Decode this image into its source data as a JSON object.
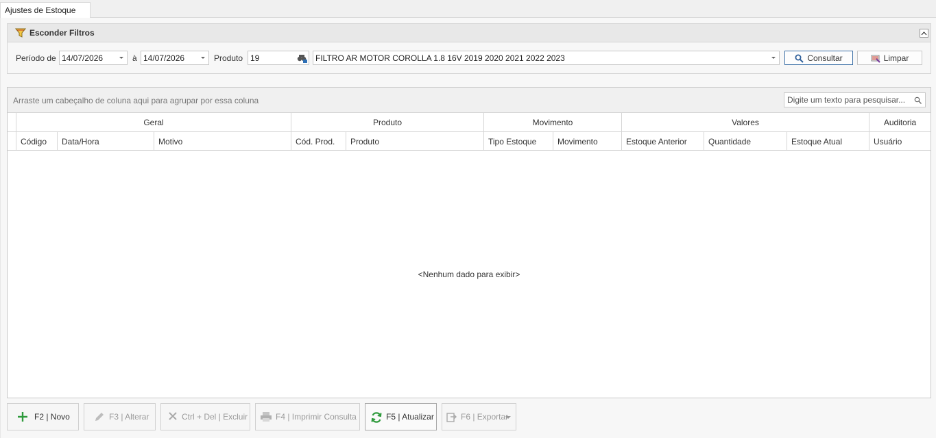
{
  "tab": {
    "label": "Ajustes de Estoque"
  },
  "filter": {
    "header_title": "Esconder Filtros",
    "periodo_label": "Período de",
    "date_from": "14/07/2026",
    "a_label": "à",
    "date_to": "14/07/2026",
    "produto_label": "Produto",
    "produto_code": "19",
    "produto_desc": "FILTRO AR MOTOR COROLLA 1.8 16V 2019 2020 2021 2022 2023",
    "consultar_label": "Consultar",
    "limpar_label": "Limpar"
  },
  "grid": {
    "group_hint": "Arraste um cabeçalho de coluna aqui para agrupar por essa coluna",
    "search_placeholder": "Digite um texto para pesquisar...",
    "bands": [
      "Geral",
      "Produto",
      "Movimento",
      "Valores",
      "Auditoria"
    ],
    "columns": [
      "Código",
      "Data/Hora",
      "Motivo",
      "Cód. Prod.",
      "Produto",
      "Tipo Estoque",
      "Movimento",
      "Estoque Anterior",
      "Quantidade",
      "Estoque Atual",
      "Usuário"
    ],
    "empty_message": "<Nenhum dado para exibir>"
  },
  "toolbar": {
    "novo": "F2 | Novo",
    "alterar": "F3 | Alterar",
    "excluir": "Ctrl + Del | Excluir",
    "imprimir": "F4 | Imprimir Consulta",
    "atualizar": "F5 | Atualizar",
    "exportar": "F6 | Exportar"
  },
  "colors": {
    "accent_green": "#2e9a3c",
    "focus_blue": "#3a6ea5"
  }
}
